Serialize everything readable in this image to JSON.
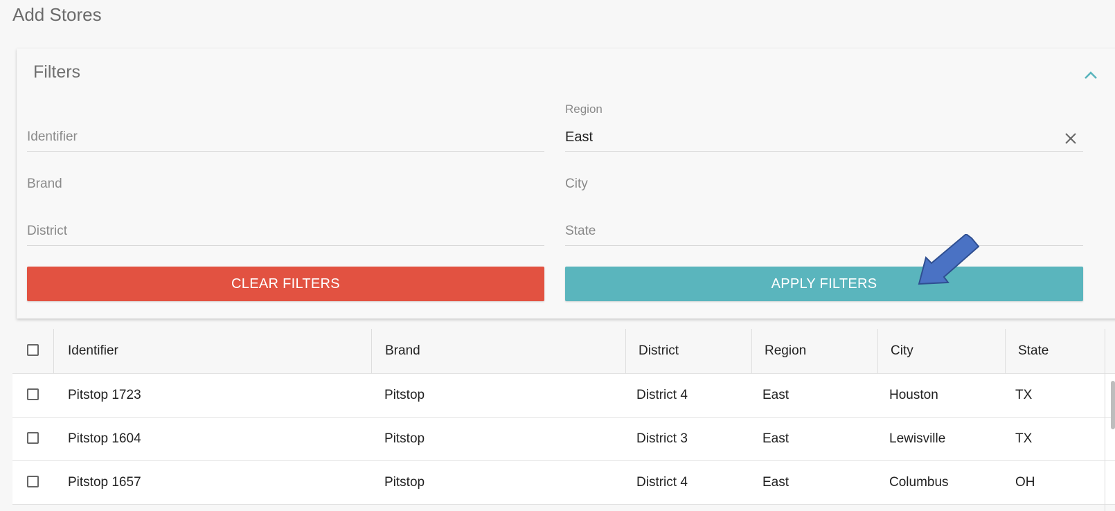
{
  "page": {
    "title": "Add Stores"
  },
  "filters": {
    "title": "Filters",
    "identifier": {
      "placeholder": "Identifier"
    },
    "region": {
      "label": "Region",
      "value": "East"
    },
    "brand": {
      "placeholder": "Brand"
    },
    "city": {
      "placeholder": "City"
    },
    "district": {
      "placeholder": "District"
    },
    "state": {
      "placeholder": "State"
    },
    "clear_label": "CLEAR FILTERS",
    "apply_label": "APPLY FILTERS"
  },
  "colors": {
    "clear_button": "#e25241",
    "apply_button": "#5ab5bd",
    "accent": "#5ab5bd",
    "annotation_arrow": "#4a72c4"
  },
  "icons": {
    "collapse": "chevron-up-icon",
    "clear_region": "close-icon",
    "annotation": "arrow-pointer-icon"
  },
  "table": {
    "columns": [
      "Identifier",
      "Brand",
      "District",
      "Region",
      "City",
      "State"
    ],
    "rows": [
      [
        "Pitstop 1723",
        "Pitstop",
        "District 4",
        "East",
        "Houston",
        "TX"
      ],
      [
        "Pitstop 1604",
        "Pitstop",
        "District 3",
        "East",
        "Lewisville",
        "TX"
      ],
      [
        "Pitstop 1657",
        "Pitstop",
        "District 4",
        "East",
        "Columbus",
        "OH"
      ]
    ]
  }
}
